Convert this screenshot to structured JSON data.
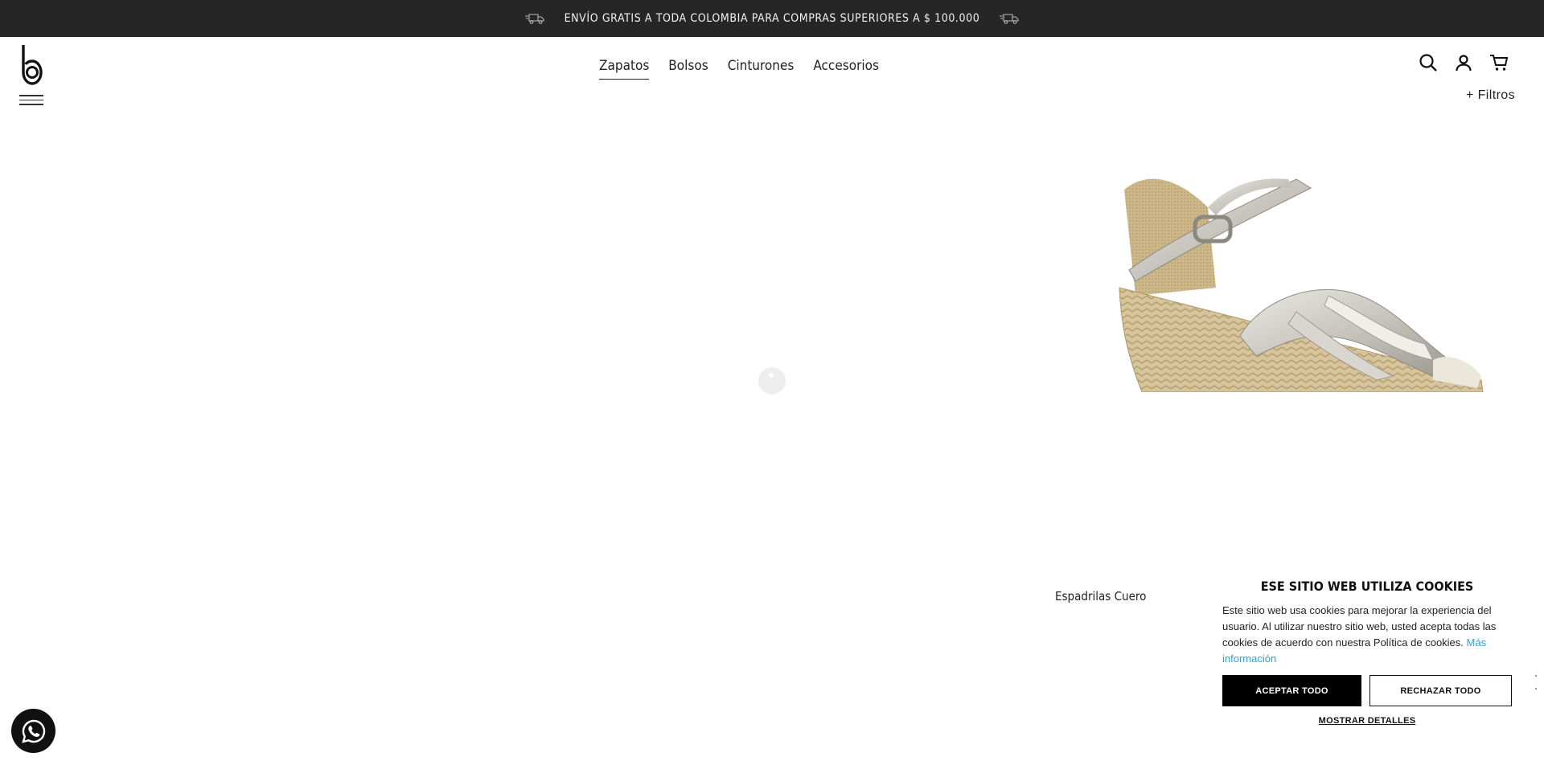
{
  "announcement": {
    "text": "ENVÍO GRATIS A TODA COLOMBIA PARA COMPRAS SUPERIORES A $ 100.000"
  },
  "nav": {
    "items": [
      {
        "label": "Zapatos",
        "active": true
      },
      {
        "label": "Bolsos",
        "active": false
      },
      {
        "label": "Cinturones",
        "active": false
      },
      {
        "label": "Accesorios",
        "active": false
      }
    ]
  },
  "filters": {
    "label": "+ Filtros"
  },
  "product": {
    "name": "Espadrilas Cuero"
  },
  "cookie": {
    "title": "ESE SITIO WEB UTILIZA COOKIES",
    "text": "Este sitio web usa cookies para mejorar la experiencia del usuario. Al utilizar nuestro sitio web, usted acepta todas las cookies de acuerdo con nuestra Política de cookies.",
    "more_link": "Más información",
    "accept_label": "ACEPTAR TODO",
    "reject_label": "RECHAZAR TODO",
    "details_label": "MOSTRAR DETALLES",
    "link_color": "#2aa7d8"
  },
  "colors": {
    "announce_bg": "#262626",
    "accent_link": "#2aa7d8"
  },
  "icons": [
    "truck-icon",
    "search-icon",
    "user-icon",
    "cart-icon",
    "menu-icon",
    "whatsapp-icon"
  ]
}
